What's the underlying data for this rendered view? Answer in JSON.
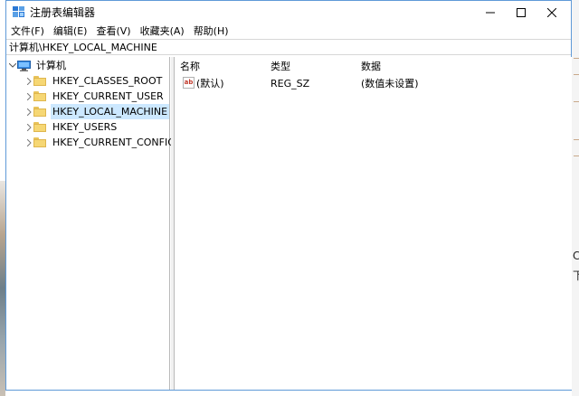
{
  "window": {
    "title": "注册表编辑器",
    "controls": {
      "minimize": "—",
      "maximize": "☐",
      "close": "✕"
    }
  },
  "menu": [
    "文件(F)",
    "编辑(E)",
    "查看(V)",
    "收藏夹(A)",
    "帮助(H)"
  ],
  "address": "计算机\\HKEY_LOCAL_MACHINE",
  "tree": {
    "root": "计算机",
    "children": [
      {
        "label": "HKEY_CLASSES_ROOT",
        "selected": false
      },
      {
        "label": "HKEY_CURRENT_USER",
        "selected": false
      },
      {
        "label": "HKEY_LOCAL_MACHINE",
        "selected": true
      },
      {
        "label": "HKEY_USERS",
        "selected": false
      },
      {
        "label": "HKEY_CURRENT_CONFIG",
        "selected": false
      }
    ]
  },
  "list": {
    "columns": [
      "名称",
      "类型",
      "数据"
    ],
    "rows": [
      {
        "name": "(默认)",
        "type": "REG_SZ",
        "data": "(数值未设置)",
        "icon": "ab-string-icon"
      }
    ]
  },
  "background": {
    "right_glyphs": [
      "C",
      "下"
    ]
  },
  "colors": {
    "selection": "#cce8ff",
    "window_border": "#5f9ad8",
    "folder": "#f6d774"
  }
}
